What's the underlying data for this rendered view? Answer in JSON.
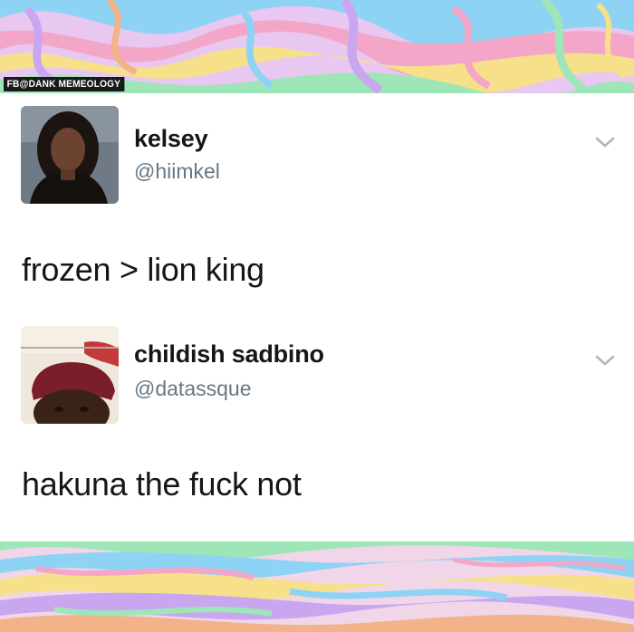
{
  "watermark": {
    "text": "FB@DANK MEMEOLOGY"
  },
  "background": {
    "pattern": "psychedelic-marble",
    "colors": [
      "#f4a6c8",
      "#8fd3f4",
      "#c9a7f0",
      "#f7e08a",
      "#9ee6b8",
      "#f3b38a"
    ]
  },
  "tweets": [
    {
      "display_name": "kelsey",
      "handle": "@hiimkel",
      "text": "frozen > lion king",
      "menu_icon": "chevron-down-icon"
    },
    {
      "display_name": "childish sadbino",
      "handle": "@datassque",
      "text": "hakuna the fuck not",
      "menu_icon": "chevron-down-icon"
    }
  ],
  "colors": {
    "name": "#14171a",
    "handle": "#657786",
    "chevron": "#aab8c2"
  }
}
